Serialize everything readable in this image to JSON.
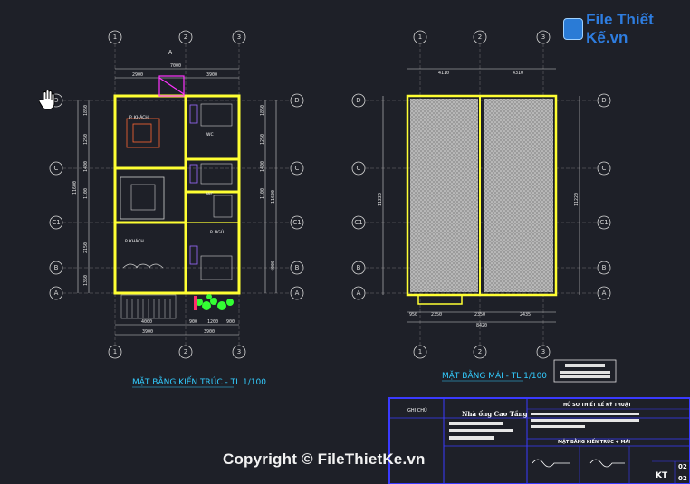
{
  "logo": {
    "text": "File Thiết Kế.vn"
  },
  "copyright": {
    "text": "Copyright © FileThietKe.vn"
  },
  "plan_left": {
    "title": "MẶT BẰNG KIẾN TRÚC - TL 1/100",
    "axes_top": [
      "1",
      "2",
      "3"
    ],
    "axes_side": [
      "D",
      "C",
      "C1",
      "B",
      "A"
    ],
    "section_mark": "A",
    "dims_top": [
      "7000",
      "2900",
      "3900"
    ],
    "dims_bottom": [
      "4000",
      "3900",
      "900",
      "1200",
      "900",
      "3900",
      "3900"
    ],
    "dims_left": [
      "1850",
      "1250",
      "1400",
      "1100",
      "2150",
      "1350",
      "5550",
      "11600"
    ],
    "dims_right": [
      "1850",
      "1250",
      "1400",
      "1100",
      "1200",
      "11600",
      "4000"
    ],
    "rooms": [
      "P. KHÁCH",
      "WC",
      "P. NGỦ",
      "WC",
      "P. NGỦ",
      "P. NGỦ",
      "P. KHÁCH"
    ]
  },
  "plan_right": {
    "title": "MẶT BẰNG MÁI - TL 1/100",
    "dims_top": [
      "4110",
      "4310"
    ],
    "dims_bottom": [
      "950",
      "2350",
      "2350",
      "2435",
      "8420"
    ],
    "dims_side": [
      "11220",
      "11220"
    ]
  },
  "title_block": {
    "left_col": "GHI CHÚ",
    "project": "Nhà ống Cao Tầng",
    "header": "HỒ SƠ THIẾT KẾ KỸ THUẬT",
    "sheet_name": "MẶT BẰNG KIẾN TRÚC + MÁI",
    "code": "KT",
    "sheet_no_1": "02",
    "sheet_no_2": "02"
  },
  "colors": {
    "background": "#1e2028",
    "wall": "#ffff33",
    "label": "#33ccff",
    "title_block": "#3a3aff",
    "roof": "#bdbdbd"
  }
}
